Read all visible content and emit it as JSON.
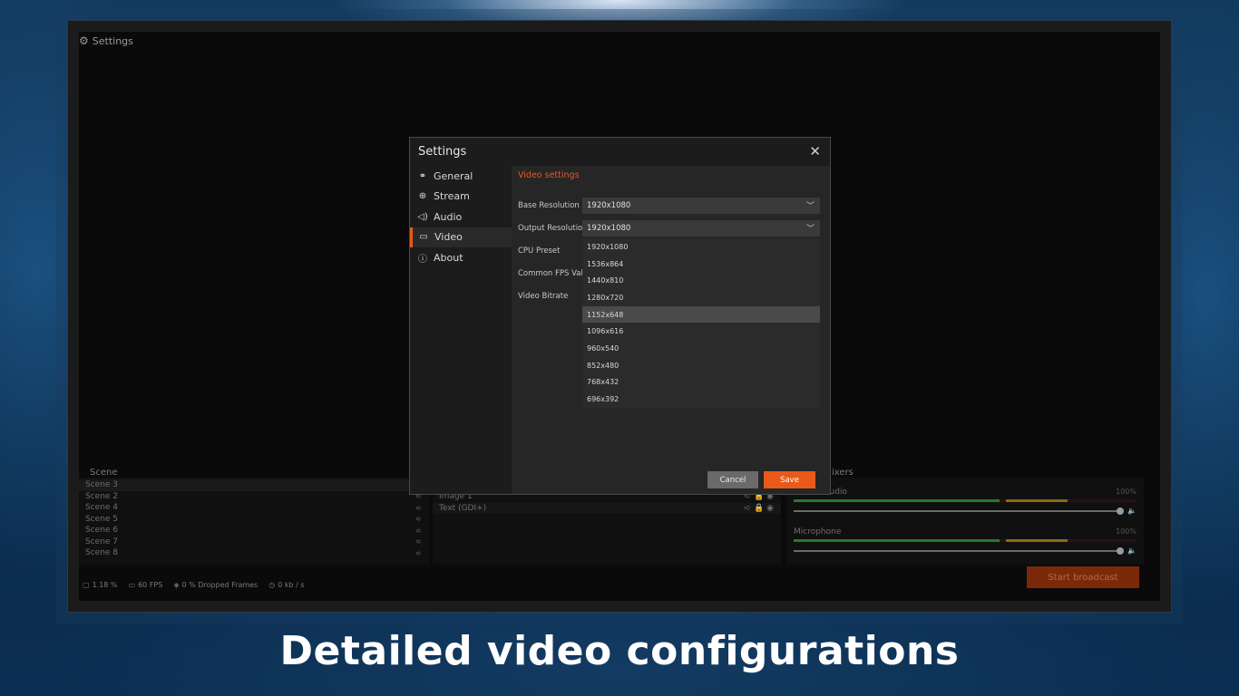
{
  "app": {
    "title": "Settings",
    "scene_label": "Scene",
    "mixers_label": "ixers",
    "scenes": [
      {
        "name": "Scene 3",
        "active": true
      },
      {
        "name": "Scene 2"
      },
      {
        "name": "Scene 4"
      },
      {
        "name": "Scene 5"
      },
      {
        "name": "Scene 6"
      },
      {
        "name": "Scene 7"
      },
      {
        "name": "Scene 8"
      }
    ],
    "sources": [
      "Image 1",
      "Text (GDI+)"
    ],
    "mixer": {
      "items": [
        {
          "name": "audio",
          "percent": "100%"
        },
        {
          "name": "Microphone",
          "percent": "100%"
        }
      ]
    },
    "status": {
      "cpu": "1.18 %",
      "fps": "60 FPS",
      "dropped": "0 % Dropped Frames",
      "bitrate": "0 kb / s"
    },
    "broadcast_label": "Start broadcast"
  },
  "dialog": {
    "title": "Settings",
    "close_glyph": "✕",
    "nav": [
      {
        "label": "General",
        "icon": "general-icon"
      },
      {
        "label": "Stream",
        "icon": "globe-icon"
      },
      {
        "label": "Audio",
        "icon": "speaker-icon"
      },
      {
        "label": "Video",
        "icon": "monitor-icon",
        "active": true
      },
      {
        "label": "About",
        "icon": "info-icon"
      }
    ],
    "section_title": "Video settings",
    "fields": {
      "base_resolution": {
        "label": "Base Resolution",
        "value": "1920x1080"
      },
      "output_resolution": {
        "label": "Output Resolution",
        "value": "1920x1080"
      },
      "cpu_preset": {
        "label": "CPU Preset"
      },
      "fps": {
        "label": "Common FPS Value"
      },
      "bitrate": {
        "label": "Video Bitrate"
      }
    },
    "resolution_options": [
      "1920x1080",
      "1536x864",
      "1440x810",
      "1280x720",
      "1152x648",
      "1096x616",
      "960x540",
      "852x480",
      "768x432",
      "696x392"
    ],
    "highlighted_option": "1152x648",
    "cancel_label": "Cancel",
    "save_label": "Save"
  },
  "caption": "Detailed video configurations",
  "colors": {
    "accent": "#e8591a",
    "dialog_bg": "#1c1c1c",
    "content_bg": "#262626"
  }
}
